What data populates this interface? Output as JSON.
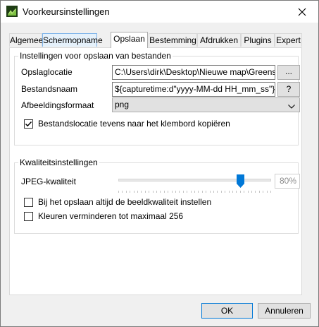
{
  "window": {
    "title": "Voorkeursinstellingen",
    "close_glyph": "✕"
  },
  "tabs": [
    {
      "label": "Algemeen"
    },
    {
      "label": "Schermopname"
    },
    {
      "label": "Opslaan"
    },
    {
      "label": "Bestemming"
    },
    {
      "label": "Afdrukken"
    },
    {
      "label": "Plugins"
    },
    {
      "label": "Expert"
    }
  ],
  "save_group": {
    "title": "Instellingen voor opslaan van bestanden",
    "location_label": "Opslaglocatie",
    "location_value": "C:\\Users\\dirk\\Desktop\\Nieuwe map\\Greenshot",
    "browse_label": "...",
    "filename_label": "Bestandsnaam",
    "filename_value": "${capturetime:d\"yyyy-MM-dd HH_mm_ss\"}-${title}",
    "help_label": "?",
    "format_label": "Afbeeldingsformaat",
    "format_value": "png",
    "copy_path_label": "Bestandslocatie tevens naar het klembord kopiëren",
    "copy_path_checked": true
  },
  "quality_group": {
    "title": "Kwaliteitsinstellingen",
    "jpeg_label": "JPEG-kwaliteit",
    "jpeg_value": 80,
    "jpeg_value_text": "80%",
    "always_quality_label": "Bij het opslaan altijd de beeldkwaliteit instellen",
    "always_quality_checked": false,
    "reduce_colors_label": "Kleuren verminderen tot maximaal 256",
    "reduce_colors_checked": false
  },
  "footer": {
    "ok_label": "OK",
    "cancel_label": "Annuleren"
  },
  "colors": {
    "accent": "#0078d7",
    "tab_hover": "#e5f1fb"
  }
}
